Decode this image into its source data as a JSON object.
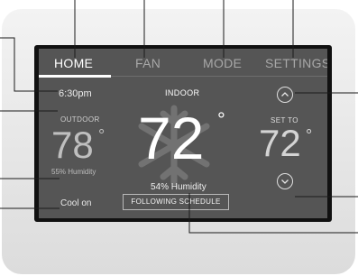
{
  "tabs": [
    {
      "label": "HOME",
      "active": true
    },
    {
      "label": "FAN",
      "active": false
    },
    {
      "label": "MODE",
      "active": false
    },
    {
      "label": "SETTINGS",
      "active": false
    }
  ],
  "time": "6:30pm",
  "indoor": {
    "label": "INDOOR",
    "temperature": "72",
    "degree_symbol": "°",
    "humidity": "54% Humidity"
  },
  "outdoor": {
    "label": "OUTDOOR",
    "temperature": "78",
    "degree_symbol": "°",
    "humidity": "55% Humidity"
  },
  "setpoint": {
    "label": "SET TO",
    "temperature": "72",
    "degree_symbol": "°"
  },
  "system_status": "Cool on",
  "schedule_button": "FOLLOWING SCHEDULE",
  "icons": {
    "background": "snowflake-icon",
    "up": "chevron-up-icon",
    "down": "chevron-down-icon"
  },
  "colors": {
    "screen": "#555555",
    "bezel": "#e6e6e6",
    "text": "#ffffff",
    "callout_line": "#1a1a1a"
  }
}
